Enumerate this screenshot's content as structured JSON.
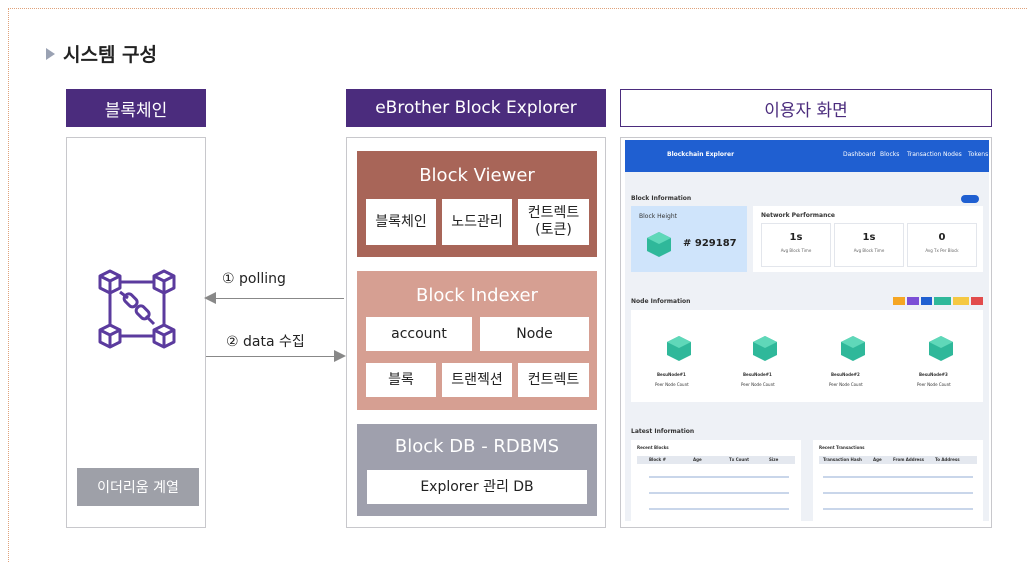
{
  "page_title": "시스템 구성",
  "columns": {
    "blockchain": {
      "header": "블록체인",
      "footer": "이더리움 계열"
    },
    "explorer": {
      "header": "eBrother Block Explorer",
      "viewer": {
        "title": "Block Viewer",
        "items": [
          "블록체인",
          "노드관리",
          "컨트렉트\n(토큰)"
        ]
      },
      "indexer": {
        "title": "Block Indexer",
        "row1": [
          "account",
          "Node"
        ],
        "row2": [
          "블록",
          "트랜젝션",
          "컨트렉트"
        ]
      },
      "db": {
        "title": "Block DB - RDBMS",
        "item": "Explorer 관리 DB"
      }
    },
    "user_screen": {
      "header": "이용자 화면",
      "mock": {
        "brand": "Blockchain Explorer",
        "nav": [
          "Dashboard",
          "Blocks",
          "Transaction",
          "Nodes",
          "Tokens"
        ],
        "block_info_label": "Block Information",
        "block_height_label": "Block Height",
        "block_height_value": "# 929187",
        "network_perf_label": "Network Performance",
        "perf": [
          {
            "value": "1s",
            "label": "Avg Block Time"
          },
          {
            "value": "1s",
            "label": "Avg Block Time"
          },
          {
            "value": "0",
            "label": "Avg Tx Per Block"
          }
        ],
        "node_info_label": "Node Information",
        "nodes": [
          "BesuNode#1",
          "BesuNode#1",
          "BesuNode#2",
          "BesuNode#3"
        ],
        "node_sub": "Peer Node Count",
        "latest_label": "Latest Information",
        "recent_blocks_label": "Recent Blocks",
        "recent_tx_label": "Recent Transactions",
        "block_cols": [
          "Block #",
          "Age",
          "Tx Count",
          "Size"
        ],
        "tx_cols": [
          "Transaction Hash",
          "Age",
          "From Address",
          "To Address"
        ]
      }
    }
  },
  "arrows": {
    "polling": "① polling",
    "collect": "② data 수집"
  },
  "colors": {
    "header_purple": "#4b2c7d",
    "viewer_bg": "#a86558",
    "indexer_bg": "#d69f92",
    "db_bg": "#9fa0ad",
    "chain_icon": "#5b3b9e"
  }
}
